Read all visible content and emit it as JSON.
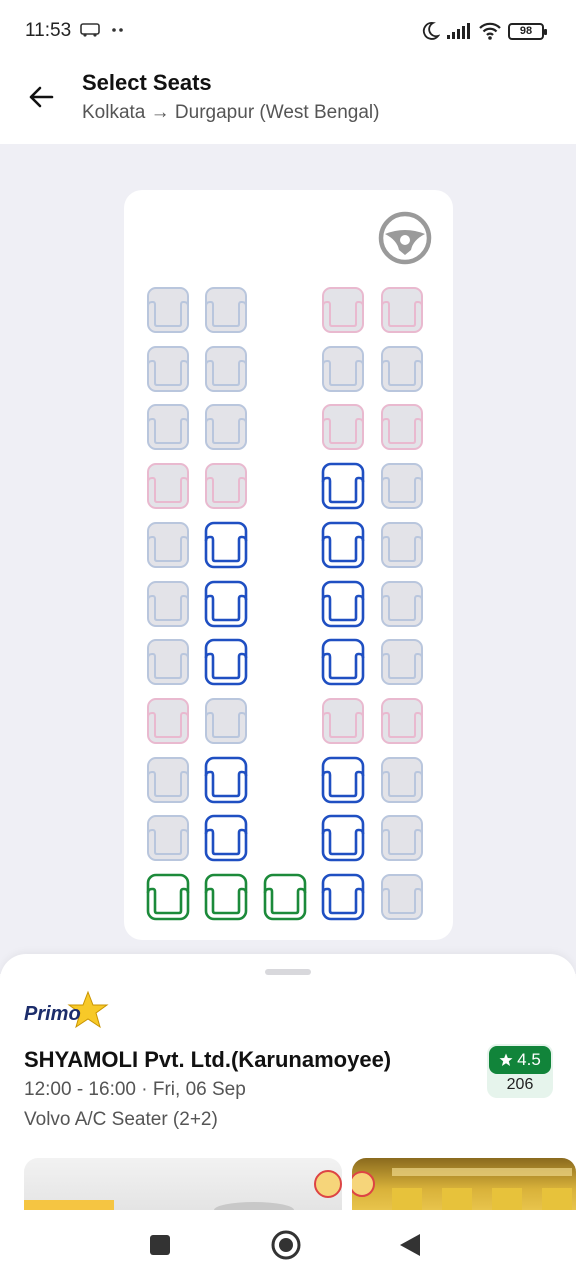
{
  "status_bar": {
    "time": "11:53",
    "battery": "98"
  },
  "header": {
    "title": "Select Seats",
    "route": "Kolkata → Durgapur (West Bengal)"
  },
  "seat_legend_colors": {
    "booked_male": "#b9c6dd",
    "booked_female": "#e9b9cf",
    "available": "#1f4fc2",
    "available_ladies": "#1c8a3a"
  },
  "seat_map": {
    "rows": [
      [
        "booked",
        "booked",
        null,
        "booked_female",
        "booked_female"
      ],
      [
        "booked",
        "booked",
        null,
        "booked",
        "booked"
      ],
      [
        "booked",
        "booked",
        null,
        "booked_female",
        "booked_female"
      ],
      [
        "booked_female",
        "booked_female",
        null,
        "available",
        "booked"
      ],
      [
        "booked",
        "available",
        null,
        "available",
        "booked"
      ],
      [
        "booked",
        "available",
        null,
        "available",
        "booked"
      ],
      [
        "booked",
        "available",
        null,
        "available",
        "booked"
      ],
      [
        "booked_female",
        "booked",
        null,
        "booked_female",
        "booked_female"
      ],
      [
        "booked",
        "available",
        null,
        "available",
        "booked"
      ],
      [
        "booked",
        "available",
        null,
        "available",
        "booked"
      ],
      [
        "available_green",
        "available_green",
        "available_green",
        "available",
        "booked"
      ]
    ]
  },
  "bus": {
    "badge": "Primo",
    "operator": "SHYAMOLI Pvt. Ltd.(Karunamoyee)",
    "timing": "12:00 - 16:00 · Fri, 06 Sep",
    "type": "Volvo A/C Seater (2+2)",
    "rating": "4.5",
    "rating_count": "206"
  }
}
